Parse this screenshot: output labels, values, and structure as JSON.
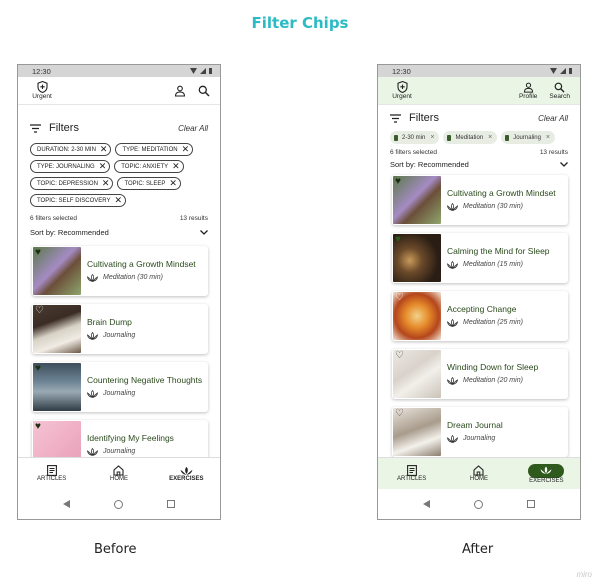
{
  "page_title": "Filter Chips",
  "watermark": "miro",
  "colors": {
    "accent_title": "#2bbbc4",
    "brand_green": "#2f5a1e",
    "app_bar_tint": "#eaf5e6"
  },
  "before": {
    "caption": "Before",
    "status_time": "12:30",
    "urgent_label": "Urgent",
    "filters_label": "Filters",
    "clear_all": "Clear All",
    "chips": [
      "DURATION: 2-30 MIN",
      "TYPE: MEDITATION",
      "TYPE: JOURNALING",
      "TOPIC: ANXIETY",
      "TOPIC: DEPRESSION",
      "TOPIC: SLEEP",
      "TOPIC: SELF DISCOVERY"
    ],
    "filters_selected": "6 filters selected",
    "results": "13 results",
    "sort_label": "Sort by: Recommended",
    "cards": [
      {
        "title": "Cultivating a Growth Mindset",
        "subtitle": "Meditation (30 min)",
        "favorited": true
      },
      {
        "title": "Brain Dump",
        "subtitle": "Journaling",
        "favorited": false
      },
      {
        "title": "Countering Negative Thoughts",
        "subtitle": "Journaling",
        "favorited": true
      },
      {
        "title": "Identifying My Feelings",
        "subtitle": "Journaling",
        "favorited": true
      }
    ],
    "nav": [
      {
        "label": "ARTICLES",
        "icon": "article-icon"
      },
      {
        "label": "HOME",
        "icon": "home-icon"
      },
      {
        "label": "EXERCISES",
        "icon": "lotus-icon",
        "active": true
      }
    ]
  },
  "after": {
    "caption": "After",
    "status_time": "12:30",
    "urgent_label": "Urgent",
    "profile_label": "Profile",
    "search_label": "Search",
    "filters_label": "Filters",
    "clear_all": "Clear All",
    "chips": [
      "2-30 min",
      "Meditation",
      "Journaling"
    ],
    "filters_selected": "6 filters selected",
    "results": "13 results",
    "sort_label": "Sort by: Recommended",
    "cards": [
      {
        "title": "Cultivating a Growth Mindset",
        "subtitle": "Meditation (30 min)",
        "favorited": true
      },
      {
        "title": "Calming the Mind for Sleep",
        "subtitle": "Meditation (15 min)",
        "favorited": true
      },
      {
        "title": "Accepting Change",
        "subtitle": "Meditation (25 min)",
        "favorited": false
      },
      {
        "title": "Winding Down for Sleep",
        "subtitle": "Meditation (20 min)",
        "favorited": false
      },
      {
        "title": "Dream Journal",
        "subtitle": "Journaling",
        "favorited": false
      }
    ],
    "nav": [
      {
        "label": "ARTICLES",
        "icon": "article-icon"
      },
      {
        "label": "HOME",
        "icon": "home-icon"
      },
      {
        "label": "EXERCISES",
        "icon": "lotus-icon",
        "active": true
      }
    ]
  }
}
